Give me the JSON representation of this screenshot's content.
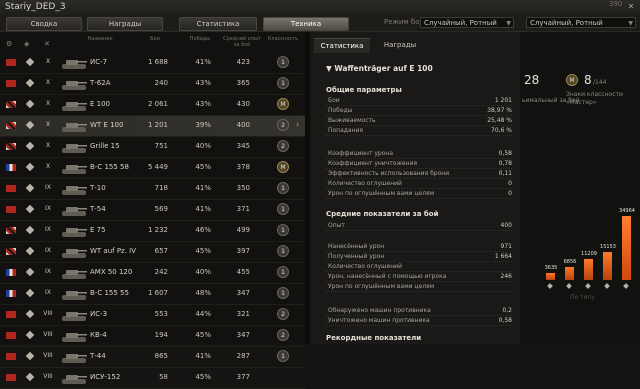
{
  "window": {
    "title": "Stariy_DED_3",
    "counter": "390",
    "close": "✕"
  },
  "tabs": [
    "Сводка",
    "Награды",
    "Статистика",
    "Техника"
  ],
  "active_tab_index": 3,
  "mode": {
    "label": "Режим боя:",
    "value": "Случайный, Ротный"
  },
  "mode2": {
    "value": "Случайный, Ротный"
  },
  "table": {
    "headers": {
      "name": "Название",
      "battles": "Бои",
      "wins": "Победы",
      "avg_xp": "Средний опыт за бой",
      "class": "Классность"
    },
    "rows": [
      {
        "nation": "ussr",
        "tier": "X",
        "name": "ИС-7",
        "battles": "1 688",
        "wins": "41%",
        "avg_xp": "423",
        "badge": "1"
      },
      {
        "nation": "ussr",
        "tier": "X",
        "name": "Т-62А",
        "battles": "240",
        "wins": "43%",
        "avg_xp": "365",
        "badge": "1"
      },
      {
        "nation": "ger",
        "tier": "X",
        "name": "E 100",
        "battles": "2 061",
        "wins": "43%",
        "avg_xp": "430",
        "badge": "M"
      },
      {
        "nation": "ger",
        "tier": "X",
        "name": "WT E 100",
        "battles": "1 201",
        "wins": "39%",
        "avg_xp": "400",
        "badge": "2",
        "selected": true
      },
      {
        "nation": "ger",
        "tier": "X",
        "name": "Grille 15",
        "battles": "751",
        "wins": "40%",
        "avg_xp": "345",
        "badge": "2"
      },
      {
        "nation": "fr",
        "tier": "X",
        "name": "B-C 155 58",
        "battles": "5 449",
        "wins": "45%",
        "avg_xp": "378",
        "badge": "M"
      },
      {
        "nation": "ussr",
        "tier": "IX",
        "name": "Т-10",
        "battles": "718",
        "wins": "41%",
        "avg_xp": "350",
        "badge": "1"
      },
      {
        "nation": "ussr",
        "tier": "IX",
        "name": "Т-54",
        "battles": "569",
        "wins": "41%",
        "avg_xp": "371",
        "badge": "1"
      },
      {
        "nation": "ger",
        "tier": "IX",
        "name": "E 75",
        "battles": "1 232",
        "wins": "46%",
        "avg_xp": "499",
        "badge": "1"
      },
      {
        "nation": "ger",
        "tier": "IX",
        "name": "WT auf Pz. IV",
        "battles": "657",
        "wins": "45%",
        "avg_xp": "397",
        "badge": "1"
      },
      {
        "nation": "fr",
        "tier": "IX",
        "name": "AMX 50 120",
        "battles": "242",
        "wins": "40%",
        "avg_xp": "455",
        "badge": "1"
      },
      {
        "nation": "fr",
        "tier": "IX",
        "name": "B-C 155 55",
        "battles": "1 607",
        "wins": "48%",
        "avg_xp": "347",
        "badge": "1"
      },
      {
        "nation": "ussr",
        "tier": "VIII",
        "name": "ИС-3",
        "battles": "553",
        "wins": "44%",
        "avg_xp": "321",
        "badge": "2"
      },
      {
        "nation": "ussr",
        "tier": "VIII",
        "name": "КВ-4",
        "battles": "194",
        "wins": "45%",
        "avg_xp": "347",
        "badge": "2"
      },
      {
        "nation": "ussr",
        "tier": "VIII",
        "name": "Т-44",
        "battles": "865",
        "wins": "41%",
        "avg_xp": "287",
        "badge": "1"
      },
      {
        "nation": "ussr",
        "tier": "VIII",
        "name": "ИСУ-152",
        "battles": "58",
        "wins": "45%",
        "avg_xp": "377",
        "badge": ""
      }
    ]
  },
  "detail": {
    "tabs": [
      "Статистика",
      "Награды"
    ],
    "title": "Waffenträger auf E 100",
    "general_title": "Общие параметры",
    "general": [
      {
        "label": "Бои",
        "value": "1 201"
      },
      {
        "label": "Победы",
        "value": "38,97 %"
      },
      {
        "label": "Выживаемость",
        "value": "25,48 %"
      },
      {
        "label": "Попадания",
        "value": "70,6 %"
      }
    ],
    "ratios": [
      {
        "label": "Коэффициент урона",
        "value": "0,58"
      },
      {
        "label": "Коэффициент уничтожения",
        "value": "0,78"
      },
      {
        "label": "Эффективность использования брони",
        "value": "0,11"
      },
      {
        "label": "Количество оглушений",
        "value": "0"
      },
      {
        "label": "Урон по оглушённым вами целям",
        "value": "0"
      }
    ],
    "avg_title": "Средние показатели за бой",
    "avg": [
      {
        "label": "Опыт",
        "value": "400"
      }
    ],
    "avg2": [
      {
        "label": "Нанесённый урон",
        "value": "971"
      },
      {
        "label": "Полученный урон",
        "value": "1 664"
      },
      {
        "label": "Количество оглушений",
        "value": ""
      },
      {
        "label": "Урон, нанесённый с помощью игрока",
        "value": "246"
      },
      {
        "label": "Урон по оглушённым вами целям",
        "value": ""
      }
    ],
    "avg3": [
      {
        "label": "Обнаружено машин противника",
        "value": "0,2"
      },
      {
        "label": "Уничтожено машин противника",
        "value": "0,58"
      }
    ],
    "records_title": "Рекордные показатели"
  },
  "right": {
    "stat1_value": "28",
    "stat1_label": "ьимальный за бой",
    "stat2_badge": "M",
    "stat2_value": "8",
    "stat2_total": "/144",
    "stat2_label1": "Знаки классности",
    "stat2_label2": "«Мастер»",
    "bars": [
      {
        "value": 3635,
        "label": "3635"
      },
      {
        "value": 6856,
        "label": "6856"
      },
      {
        "value": 11209,
        "label": "11209"
      },
      {
        "value": 15153,
        "label": "15153"
      },
      {
        "value": 34964,
        "label": "34964"
      }
    ],
    "axis_label": "По типу"
  }
}
